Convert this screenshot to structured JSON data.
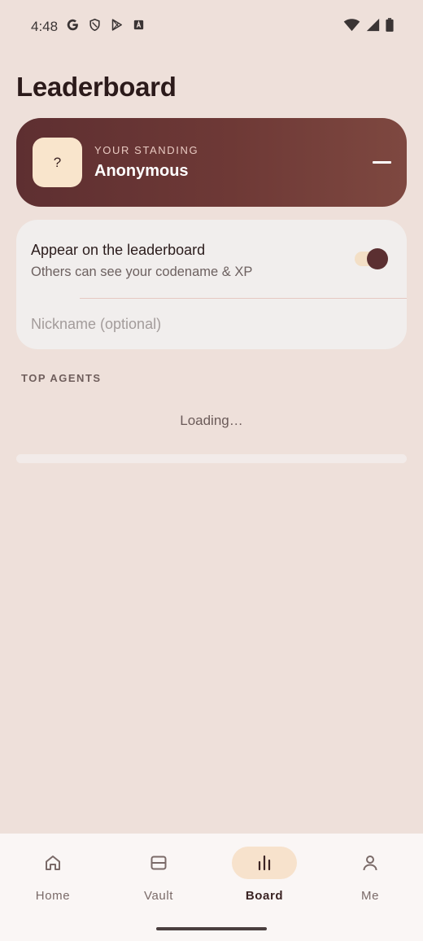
{
  "status_bar": {
    "time": "4:48",
    "left_icons": [
      "google-icon",
      "shield-icon",
      "play-store-icon",
      "text-icon"
    ],
    "right_icons": [
      "wifi-icon",
      "signal-icon",
      "battery-icon"
    ]
  },
  "page": {
    "title": "Leaderboard"
  },
  "standing": {
    "avatar_text": "?",
    "label": "YOUR STANDING",
    "name": "Anonymous"
  },
  "settings": {
    "toggle_title": "Appear on the leaderboard",
    "toggle_subtitle": "Others can see your codename & XP",
    "toggle_on": true,
    "nickname_value": "",
    "nickname_placeholder": "Nickname (optional)"
  },
  "top_agents": {
    "label": "TOP AGENTS",
    "loading_text": "Loading…"
  },
  "nav": {
    "items": [
      {
        "label": "Home",
        "icon": "home-icon",
        "active": false
      },
      {
        "label": "Vault",
        "icon": "vault-icon",
        "active": false
      },
      {
        "label": "Board",
        "icon": "bar-chart-icon",
        "active": true
      },
      {
        "label": "Me",
        "icon": "person-icon",
        "active": false
      }
    ]
  },
  "colors": {
    "background": "#eee0da",
    "accent_dark": "#5e2f31",
    "accent_light": "#f7e2cc"
  }
}
